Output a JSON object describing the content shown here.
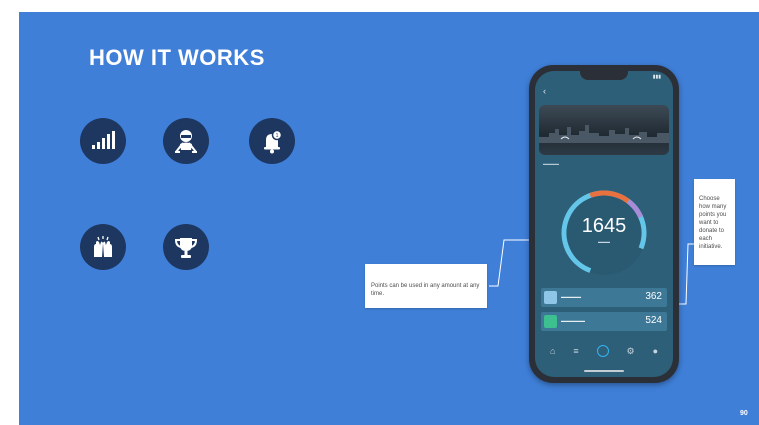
{
  "slide": {
    "title": "HOW IT WORKS",
    "icons": [
      "signal-bars-icon",
      "hockey-player-icon",
      "notification-bell-icon",
      "clapping-hands-icon",
      "trophy-icon"
    ]
  },
  "phone": {
    "points": "1645",
    "rows": [
      {
        "value": "362",
        "icon_color": "#8fc6e8"
      },
      {
        "value": "524",
        "icon_color": "#3dbf8f"
      }
    ],
    "ring_colors": [
      "#64c6e8",
      "#e9713f",
      "#a98cd8"
    ]
  },
  "callouts": {
    "left": "Points can be used in any amount at any time.",
    "right": "Choose how many points you want to donate to each initiative."
  },
  "corner_logo": "90",
  "colors": {
    "background": "#3f7fd8",
    "icon_circle": "#1d3760",
    "phone_screen": "#2e5f79"
  }
}
